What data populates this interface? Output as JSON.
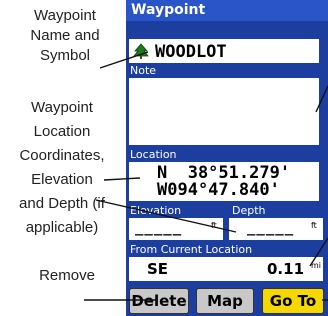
{
  "callouts": {
    "name_symbol": [
      "Waypoint",
      "Name and",
      "Symbol"
    ],
    "location": [
      "Waypoint",
      "Location",
      "Coordinates,",
      "Elevation",
      "and Depth (if",
      "applicable)"
    ],
    "remove": "Remove"
  },
  "device": {
    "title": "Waypoint",
    "waypoint_name": "WOODLOT",
    "symbol_icon": "tree-symbol-icon",
    "note_label": "Note",
    "note_text": "",
    "location_label": "Location",
    "latitude": "N  38°51.279'",
    "longitude": "W094°47.840'",
    "elevation_label": "Elevation",
    "elevation_value": "_____",
    "elevation_unit": "ft",
    "depth_label": "Depth",
    "depth_value": "_____",
    "depth_unit": "ft",
    "from_current_label": "From Current Location",
    "bearing": "SE",
    "distance": "0.11",
    "distance_unit": "mi",
    "buttons": {
      "delete": "Delete",
      "map": "Map",
      "goto": "Go To"
    }
  },
  "colors": {
    "device_blue": "#1c3f9f",
    "title_blue": "#2a55c8",
    "button_gray": "#c8c8c8",
    "goto_yellow": "#f5d800"
  }
}
